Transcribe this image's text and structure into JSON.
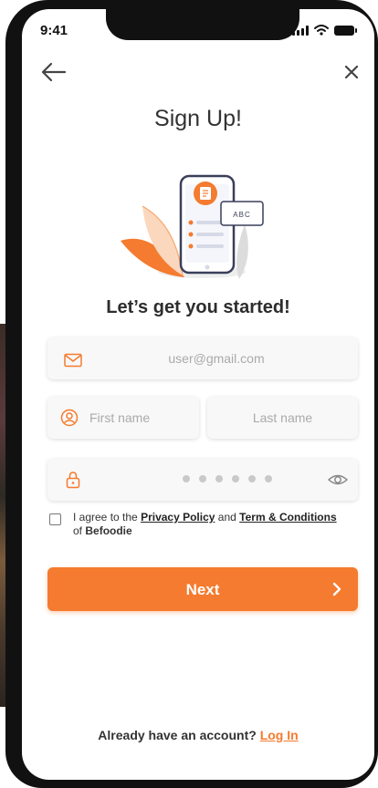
{
  "status_bar": {
    "time": "9:41"
  },
  "title": "Sign Up!",
  "illustration": {
    "card_text": "ABC"
  },
  "subtitle": "Let’s get you started!",
  "form": {
    "email_placeholder": "user@gmail.com",
    "first_name_placeholder": "First name",
    "last_name_placeholder": "Last name",
    "password_masked_length": 6
  },
  "agreement": {
    "prefix": "I agree to the",
    "privacy_link": "Privacy Policy",
    "conjunction": "and",
    "terms_link": "Term & Conditions",
    "suffix": "of",
    "brand": "Befoodie"
  },
  "next_label": "Next",
  "footer": {
    "prompt": "Already have an account?",
    "login_link": "Log In"
  },
  "colors": {
    "accent": "#f47b2f",
    "text": "#333333",
    "field_bg": "#f8f8f8"
  },
  "icons": {
    "back": "arrow-left-icon",
    "close": "close-icon",
    "email": "envelope-icon",
    "user": "user-circle-icon",
    "password": "lock-icon",
    "show_password": "eye-icon",
    "next": "chevron-right-icon"
  }
}
